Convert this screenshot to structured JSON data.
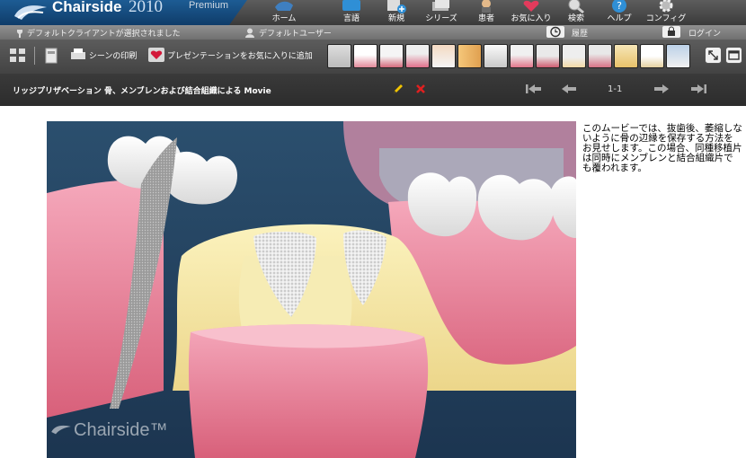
{
  "app": {
    "name": "Chairside",
    "year": "2010",
    "edition": "Premium"
  },
  "nav": [
    {
      "label": "ホーム",
      "icon": "home-icon"
    },
    {
      "label": "言語",
      "icon": "language-icon"
    },
    {
      "label": "新規",
      "icon": "new-icon"
    },
    {
      "label": "シリーズ",
      "icon": "series-icon"
    },
    {
      "label": "患者",
      "icon": "patient-icon"
    },
    {
      "label": "お気に入り",
      "icon": "favorites-icon"
    },
    {
      "label": "検索",
      "icon": "search-icon"
    },
    {
      "label": "ヘルプ",
      "icon": "help-icon"
    },
    {
      "label": "コンフィグ",
      "icon": "config-icon"
    }
  ],
  "status": {
    "client": "デフォルトクライアントが選択されました",
    "user": "デフォルトユーザー",
    "history": "履歴",
    "login": "ログイン"
  },
  "toolbar": {
    "print": "シーンの印刷",
    "add_favorite": "プレゼンテーションをお気に入りに追加"
  },
  "presentation": {
    "title": "リッジプリザベーション 骨、メンブレンおよび結合組織による Movie",
    "pager": "1-1"
  },
  "description": "このムービーでは、抜歯後、萎縮しないように骨の辺縁を保存する方法をお見せします。この場合、同種移植片は同時にメンブレンと結合組織片でも覆われます。",
  "watermark": "Chairside™",
  "colors": {
    "header_blue": "#1d5c94",
    "toolbar": "#4f4f4f",
    "titlebar": "#333333",
    "accent_red": "#e02020",
    "accent_yellow": "#f2c400"
  }
}
